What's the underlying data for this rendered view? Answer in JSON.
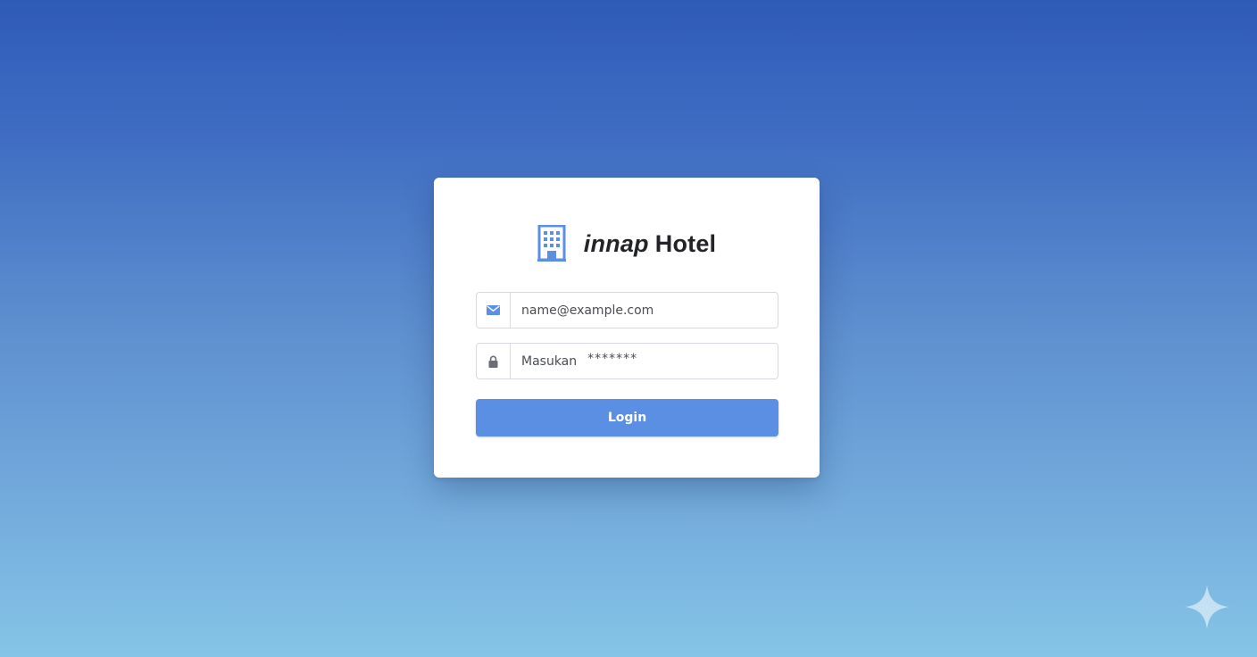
{
  "brand": {
    "name_italic": "innap",
    "name_rest": "Hotel",
    "logo_icon": "hotel-building-icon",
    "accent_color": "#5b8fe3"
  },
  "form": {
    "email": {
      "icon": "envelope-icon",
      "value": "name@example.com"
    },
    "password": {
      "icon": "lock-icon",
      "label": "Masukan",
      "mask": "*******"
    },
    "login_button": {
      "label": "Login",
      "color": "#5b8fe3"
    }
  },
  "decoration": {
    "corner_icon": "sparkle-icon"
  }
}
